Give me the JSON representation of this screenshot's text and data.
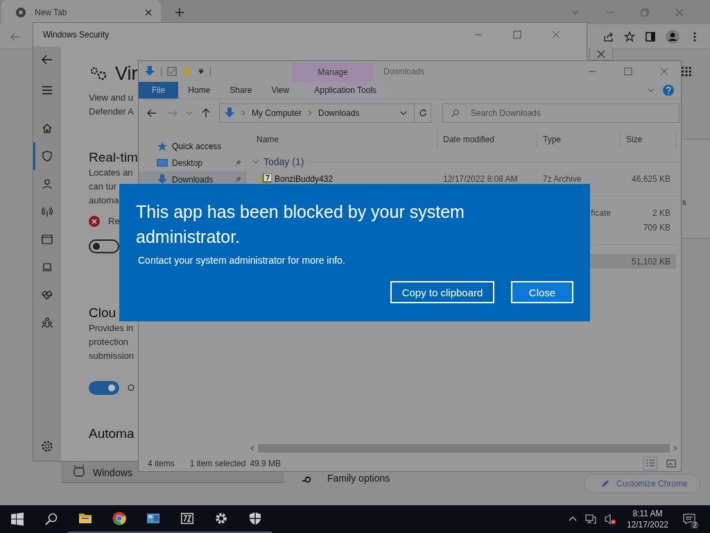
{
  "browser": {
    "tab": {
      "title": "New Tab"
    },
    "side_text": "s",
    "customize_button": "Customize Chrome"
  },
  "background_settings": {
    "items": [
      {
        "label": "Windows"
      },
      {
        "label": "Family options"
      }
    ]
  },
  "security": {
    "title": "Windows Security",
    "heading": "Vir",
    "description": [
      "View and u",
      "Defender A"
    ],
    "nav": [
      {
        "kind": "home",
        "selected": false
      },
      {
        "kind": "shield",
        "selected": true
      },
      {
        "kind": "person",
        "selected": false
      },
      {
        "kind": "antenna",
        "selected": false
      },
      {
        "kind": "window",
        "selected": false
      },
      {
        "kind": "laptop",
        "selected": false
      },
      {
        "kind": "heart",
        "selected": false
      },
      {
        "kind": "family",
        "selected": false
      }
    ],
    "sections": [
      {
        "title": "Real-tim",
        "lines": [
          "Locates an",
          "can tur",
          "automa"
        ],
        "status": {
          "kind": "error",
          "text": "Re"
        },
        "toggle": {
          "on": false
        }
      },
      {
        "title": "Clou",
        "lines": [
          "Provides in",
          "protection",
          "submission"
        ],
        "toggle": {
          "on": true,
          "label": "O"
        }
      },
      {
        "title": "Automa"
      }
    ]
  },
  "explorer": {
    "title": "Downloads",
    "context_tab": "Manage",
    "ribbon_tabs": [
      {
        "label": "File",
        "selected": true
      },
      {
        "label": "Home",
        "selected": false
      },
      {
        "label": "Share",
        "selected": false
      },
      {
        "label": "View",
        "selected": false
      },
      {
        "label": "Application Tools",
        "selected": false
      }
    ],
    "path": [
      "My Computer",
      "Downloads"
    ],
    "search": {
      "placeholder": "Search Downloads"
    },
    "nav": [
      {
        "label": "Quick access",
        "kind": "star",
        "pinned": false,
        "selected": false
      },
      {
        "label": "Desktop",
        "kind": "desktop",
        "pinned": true,
        "selected": false
      },
      {
        "label": "Downloads",
        "kind": "download",
        "pinned": true,
        "selected": true
      }
    ],
    "columns": [
      "Name",
      "Date modified",
      "Type",
      "Size"
    ],
    "groups": [
      {
        "label": "Today (1)",
        "rows": [
          {
            "name": "BonziBuddy432",
            "date": "12/17/2022 8:08 AM",
            "type": "7z Archive",
            "size": "46,625 KB",
            "selected": false
          }
        ]
      },
      {
        "rows": [
          {
            "type": "ficate",
            "size": "2 KB",
            "selected": false
          },
          {
            "size": "709 KB",
            "selected": false
          }
        ]
      },
      {
        "rows": [
          {
            "size": "51,102 KB",
            "selected": true
          }
        ]
      }
    ],
    "status": {
      "count": "4 items",
      "selection": "1 item selected",
      "size": "49.9 MB"
    }
  },
  "dialog": {
    "title": "This app has been blocked by your system administrator.",
    "message": "Contact your system administrator for more info.",
    "buttons": [
      {
        "label": "Copy to clipboard",
        "kind": "secondary"
      },
      {
        "label": "Close",
        "kind": "primary"
      }
    ]
  },
  "taskbar": {
    "apps": [
      {
        "kind": "start",
        "running": false
      },
      {
        "kind": "search",
        "running": false
      },
      {
        "kind": "folder",
        "running": true
      },
      {
        "kind": "chrome",
        "running": true
      },
      {
        "kind": "panel",
        "running": true
      },
      {
        "kind": "archive",
        "running": true
      },
      {
        "kind": "gear",
        "running": true
      },
      {
        "kind": "shield",
        "running": true
      }
    ],
    "time": "8:11 AM",
    "date": "12/17/2022",
    "volume_muted": true,
    "notifications": "2"
  }
}
